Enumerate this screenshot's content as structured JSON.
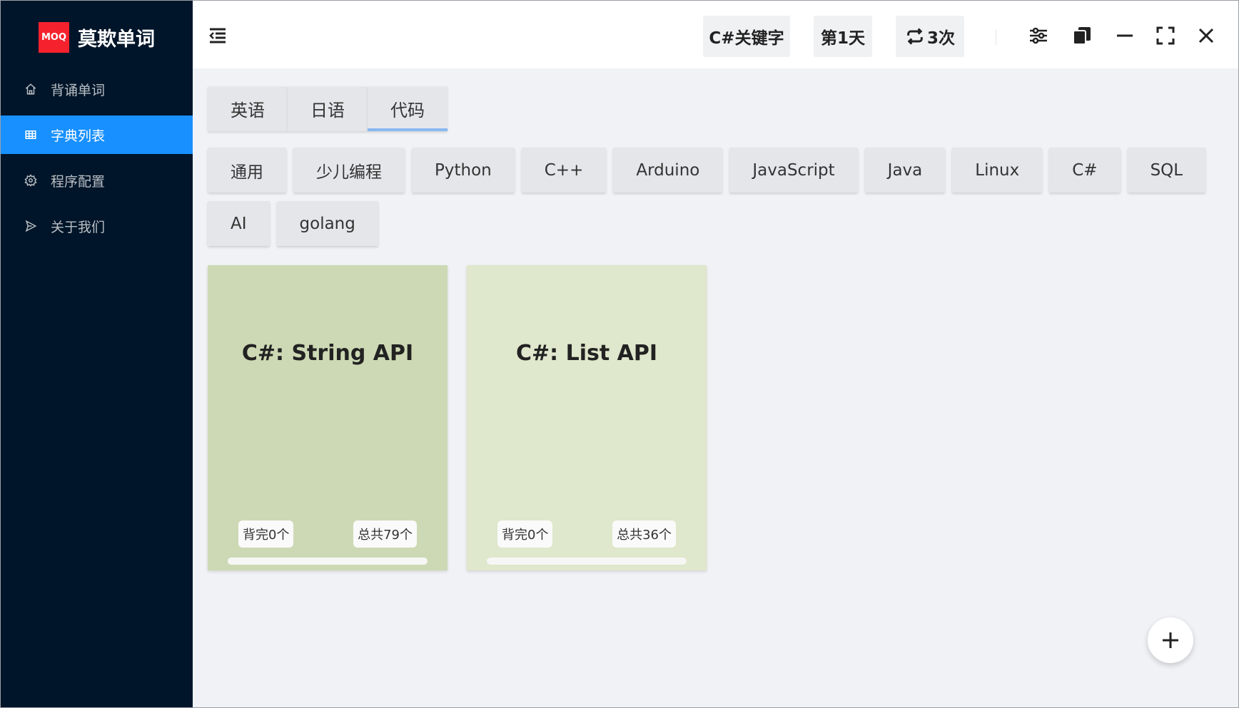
{
  "app": {
    "logo_badge": "MOQ",
    "name": "莫欺单词",
    "brand_color": "#f5222d",
    "sidebar_bg": "#001529",
    "accent": "#1890ff"
  },
  "sidebar": {
    "items": [
      {
        "label": "背诵单词",
        "icon": "home-icon",
        "active": false
      },
      {
        "label": "字典列表",
        "icon": "table-icon",
        "active": true
      },
      {
        "label": "程序配置",
        "icon": "gear-icon",
        "active": false
      },
      {
        "label": "关于我们",
        "icon": "send-icon",
        "active": false
      }
    ]
  },
  "header": {
    "current_dict": "C#关键字",
    "day": "第1天",
    "repeat": "3次",
    "icons": [
      "menu-fold-icon",
      "repeat-icon",
      "sliders-icon",
      "copy-icon",
      "minimize-icon",
      "fullscreen-icon",
      "close-icon"
    ]
  },
  "tabs": {
    "items": [
      "英语",
      "日语",
      "代码"
    ],
    "active_index": 2
  },
  "categories": [
    "通用",
    "少儿编程",
    "Python",
    "C++",
    "Arduino",
    "JavaScript",
    "Java",
    "Linux",
    "C#",
    "SQL",
    "AI",
    "golang"
  ],
  "cards": [
    {
      "title": "C#: String API",
      "learned": "背完0个",
      "total": "总共79个",
      "bg": "#cdd9b4",
      "progress": 0
    },
    {
      "title": "C#: List API",
      "learned": "背完0个",
      "total": "总共36个",
      "bg": "#dfe7cc",
      "progress": 0
    }
  ],
  "fab": {
    "icon": "plus-icon"
  }
}
